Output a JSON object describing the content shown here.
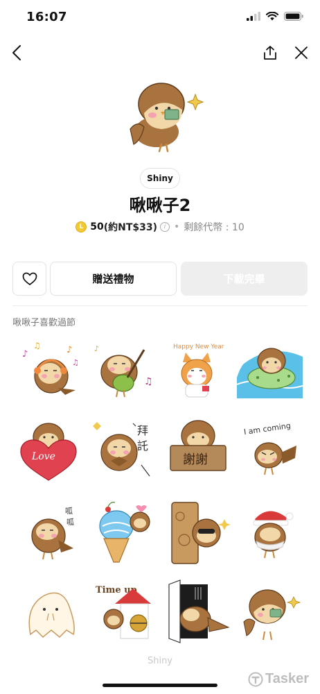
{
  "status_bar": {
    "time": "16:07"
  },
  "nav": {
    "back_icon": "chevron-left-icon",
    "share_icon": "share-icon",
    "close_icon": "close-icon"
  },
  "product": {
    "brand": "Shiny",
    "title": "啾啾子2",
    "coin_icon": "coin-icon",
    "coin_letter": "L",
    "price": "50",
    "price_nt": "(約NT$33)",
    "separator": "•",
    "remaining": "剩餘代幣 : 10"
  },
  "actions": {
    "favorite_icon": "heart-icon",
    "gift_label": "贈送禮物",
    "download_label": "下載完畢"
  },
  "section": {
    "title": "啾啾子喜歡過節"
  },
  "stickers": [
    {
      "name": "sticker-music-bird"
    },
    {
      "name": "sticker-guitar-bird",
      "text": ""
    },
    {
      "name": "sticker-happy-new-year",
      "text": "Happy New Year"
    },
    {
      "name": "sticker-swim-ring-bird"
    },
    {
      "name": "sticker-love-heart",
      "text": "Love"
    },
    {
      "name": "sticker-bai-tuo",
      "text": "拜託"
    },
    {
      "name": "sticker-xie-xie",
      "text": "謝謝"
    },
    {
      "name": "sticker-i-am-coming",
      "text": "I am coming"
    },
    {
      "name": "sticker-sleepy-bird",
      "text": "呱呱"
    },
    {
      "name": "sticker-ice-cream-bird"
    },
    {
      "name": "sticker-cool-log-bird"
    },
    {
      "name": "sticker-christmas-bird"
    },
    {
      "name": "sticker-ghost"
    },
    {
      "name": "sticker-time-up",
      "text": "Time up"
    },
    {
      "name": "sticker-door-bird"
    },
    {
      "name": "sticker-money-bird"
    }
  ],
  "footer": {
    "label": "Shiny",
    "watermark": "Tasker"
  },
  "colors": {
    "bird_brown": "#a8733f",
    "bird_face": "#f2d8a8",
    "cheek": "#f4a3b0",
    "coin": "#f3c932",
    "heart_red": "#e0424f",
    "disabled_btn": "#eeeeee"
  }
}
